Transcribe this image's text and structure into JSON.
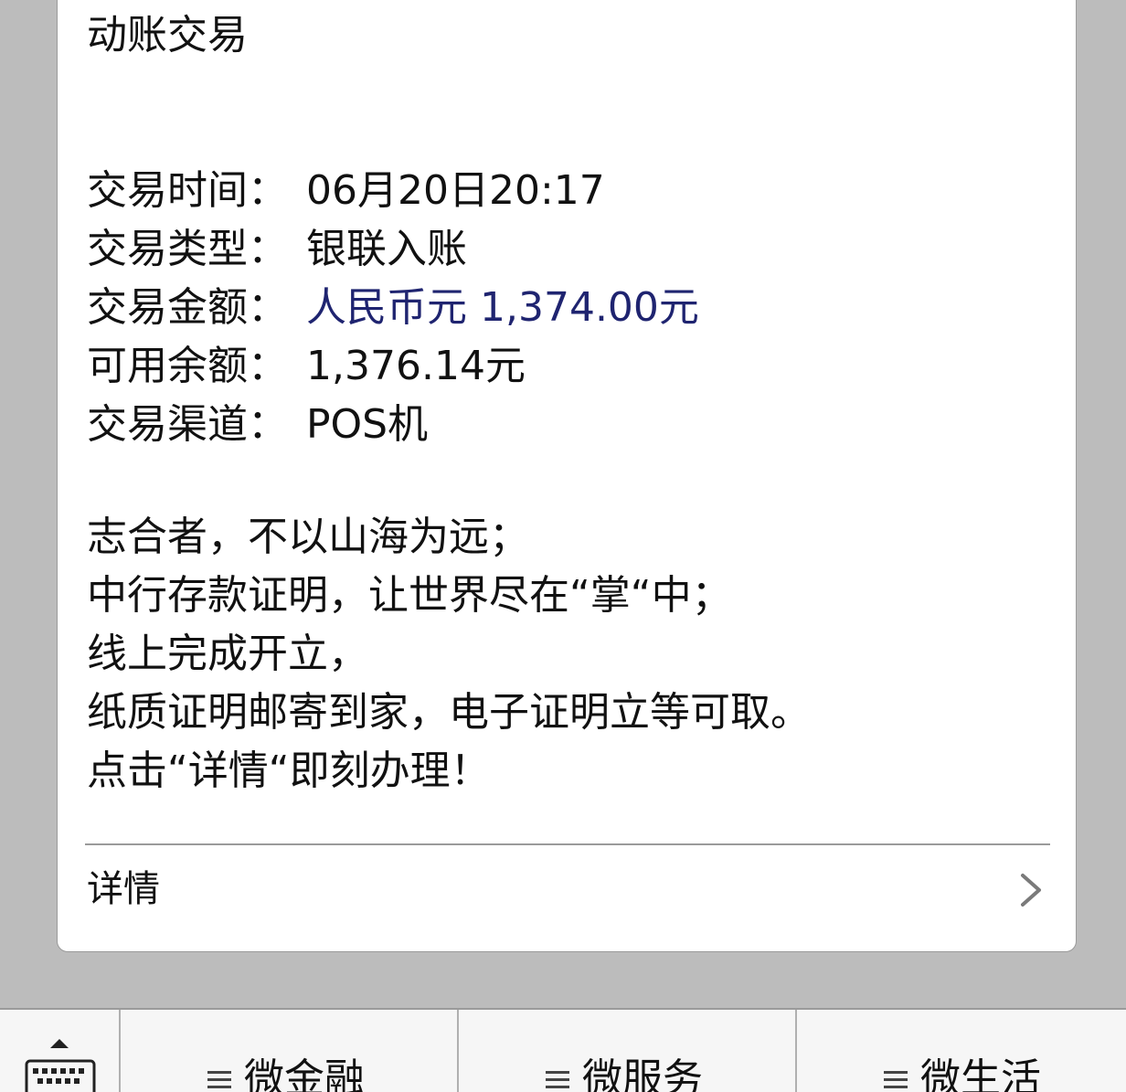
{
  "message": {
    "title": "动账交易",
    "fields": [
      {
        "label": "交易时间：",
        "value": "06月20日20:17"
      },
      {
        "label": "交易类型：",
        "value": "银联入账"
      },
      {
        "label": "交易金额：",
        "value": "人民币元 1,374.00元"
      },
      {
        "label": "可用余额：",
        "value": "1,376.14元"
      },
      {
        "label": "交易渠道：",
        "value": "POS机"
      }
    ],
    "promo_lines": [
      "志合者，不以山海为远；",
      "中行存款证明，让世界尽在“掌“中；",
      "线上完成开立，",
      "纸质证明邮寄到家，电子证明立等可取。",
      "点击“详情“即刻办理！"
    ],
    "detail_label": "详情",
    "detail_icon": "chevron-right-icon"
  },
  "bottom_menu": {
    "keyboard_icon": "keyboard-icon",
    "items": [
      {
        "label": "微金融",
        "icon": "menu-lines-icon"
      },
      {
        "label": "微服务",
        "icon": "menu-lines-icon"
      },
      {
        "label": "微生活",
        "icon": "menu-lines-icon"
      }
    ]
  },
  "colors": {
    "amount_text": "#1f2470",
    "background": "#bcbcbc",
    "card": "#ffffff"
  }
}
